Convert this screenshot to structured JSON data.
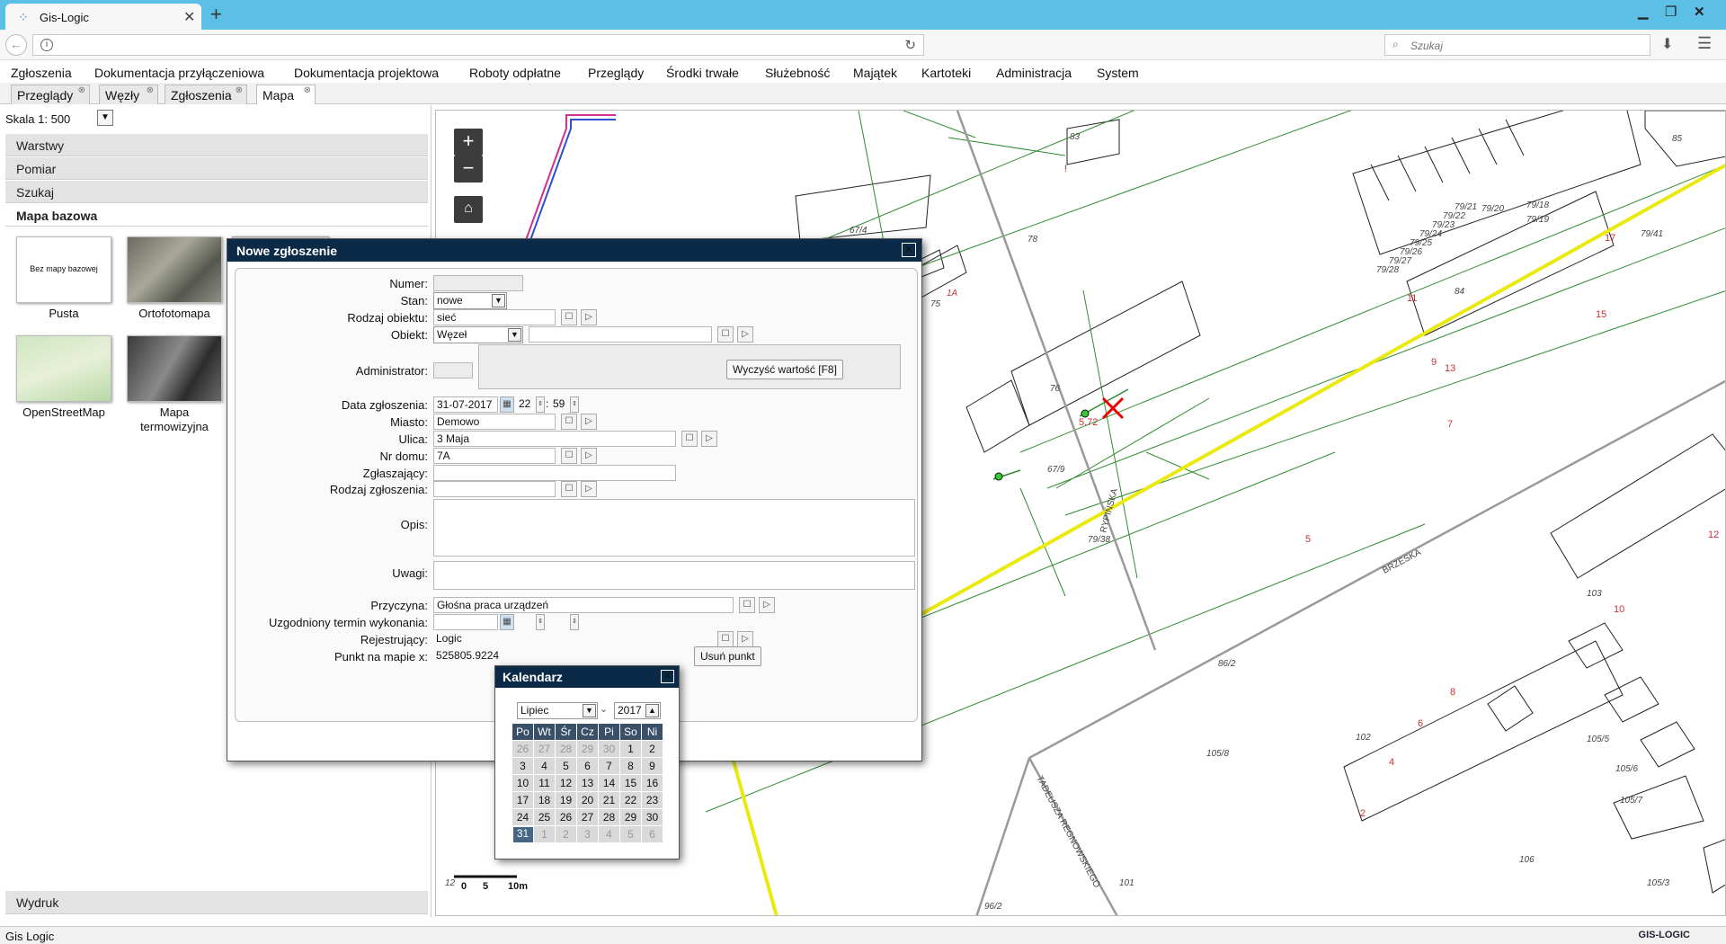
{
  "browser": {
    "tab_title": "Gis-Logic",
    "search_placeholder": "Szukaj"
  },
  "menu": [
    "Zgłoszenia",
    "Dokumentacja przyłączeniowa",
    "Dokumentacja projektowa",
    "Roboty odpłatne",
    "Przeglądy",
    "Środki trwałe",
    "Służebność",
    "Majątek",
    "Kartoteki",
    "Administracja",
    "System"
  ],
  "app_tabs": [
    "Przeglądy",
    "Węzły",
    "Zgłoszenia",
    "Mapa"
  ],
  "left": {
    "scale_label": "Skala 1: 500",
    "accordion": [
      "Warstwy",
      "Pomiar",
      "Szukaj",
      "Mapa bazowa"
    ],
    "basemaps": [
      {
        "label": "Pusta",
        "inner": "Bez mapy bazowej"
      },
      {
        "label": "Ortofotomapa"
      },
      {
        "label": "OpenStreetMap"
      },
      {
        "label": "Mapa termowizyjna"
      }
    ],
    "print": "Wydruk"
  },
  "dialog": {
    "title": "Nowe zgłoszenie",
    "labels": {
      "numer": "Numer:",
      "stan": "Stan:",
      "rodzaj_obiektu": "Rodzaj obiektu:",
      "obiekt": "Obiekt:",
      "administrator": "Administrator:",
      "data": "Data zgłoszenia:",
      "miasto": "Miasto:",
      "ulica": "Ulica:",
      "nr_domu": "Nr domu:",
      "zglaszajacy": "Zgłaszający:",
      "rodzaj_zgloszenia": "Rodzaj zgłoszenia:",
      "opis": "Opis:",
      "uwagi": "Uwagi:",
      "przyczyna": "Przyczyna:",
      "termin": "Uzgodniony termin wykonania:",
      "rejestrujacy": "Rejestrujący:",
      "punkt": "Punkt na mapie x:"
    },
    "values": {
      "stan": "nowe",
      "rodzaj_obiektu": "sieć",
      "obiekt": "Węzeł",
      "date": "31-07-2017",
      "hour": "22",
      "minute": "59",
      "miasto": "Demowo",
      "ulica": "3 Maja",
      "nr_domu": "7A",
      "przyczyna": "Głośna praca urządzeń",
      "rejestrujacy": "Logic",
      "punkt_x": "525805.9224"
    },
    "clear_button": "Wyczyść wartość [F8]",
    "remove_point": "Usuń punkt"
  },
  "calendar": {
    "title": "Kalendarz",
    "month": "Lipiec",
    "year": "2017",
    "weekdays": [
      "Po",
      "Wt",
      "Śr",
      "Cz",
      "Pi",
      "So",
      "Ni"
    ],
    "weeks": [
      [
        "26",
        "27",
        "28",
        "29",
        "30",
        "1",
        "2"
      ],
      [
        "3",
        "4",
        "5",
        "6",
        "7",
        "8",
        "9"
      ],
      [
        "10",
        "11",
        "12",
        "13",
        "14",
        "15",
        "16"
      ],
      [
        "17",
        "18",
        "19",
        "20",
        "21",
        "22",
        "23"
      ],
      [
        "24",
        "25",
        "26",
        "27",
        "28",
        "29",
        "30"
      ],
      [
        "31",
        "1",
        "2",
        "3",
        "4",
        "5",
        "6"
      ]
    ]
  },
  "map": {
    "labels": [
      "83",
      "85",
      "79/41",
      "84",
      "67/4",
      "78",
      "76",
      "75",
      "1A",
      "67/9",
      "79/38",
      "103",
      "86/2",
      "102",
      "105/8",
      "101",
      "106",
      "96/2",
      "105/5",
      "105/6",
      "105/7",
      "105/3",
      "79/28",
      "79/27",
      "79/26",
      "79/25",
      "79/24",
      "79/23",
      "79/22",
      "79/21",
      "79/20",
      "79/19",
      "79/18",
      "12"
    ],
    "streets": [
      "RYPIŃSKA",
      "BRZESKA",
      "TADEUSZA REGNOWSKIEGO"
    ],
    "scalebar": [
      "0",
      "5",
      "10m"
    ]
  },
  "status": {
    "left": "Gis Logic",
    "logo": "GIS-LOGIC"
  }
}
